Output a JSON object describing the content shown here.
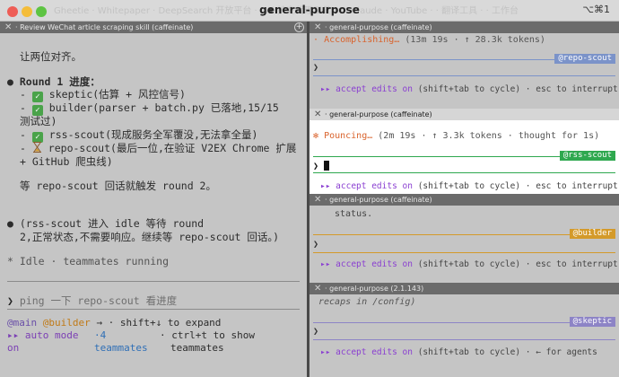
{
  "window": {
    "title": "general-purpose",
    "shortcut": "⌥⌘1",
    "ghost_tabs": "Gheetie · Whitepaper · DeepSearch 开放平台 ·  · Ai 扩充代理工具 ·  ·  · Claude · YouTube ·  · 翻译工具 ·  · 工作台"
  },
  "left_pane": {
    "header": "Review WeChat article scraping skill (caffeinate)",
    "lines": {
      "l1": "让两位对齐。",
      "progress_title": "Round 1 进度：",
      "i1": "skeptic(估算 + 风控信号)",
      "i2a": "builder(parser + batch.py 已落地,15/15",
      "i2b": "测试过)",
      "i3": "rss-scout(现成服务全军覆没,无法拿全量)",
      "i4a": "repo-scout(最后一位,在验证 V2EX Chrome 扩展",
      "i4b": "+ GitHub 爬虫线)",
      "wait": "等  repo-scout 回话就触发  round 2。",
      "p1": "(rss-scout 进入  idle 等待  round",
      "p2": "2,正常状态,不需要响应。继续等  repo-scout 回话。)",
      "idle": "Idle · teammates running"
    },
    "prompt_symbol": "❯",
    "input_value": "ping 一下  repo-scout 看进度",
    "footer": {
      "main": "@main",
      "builder": "@builder",
      "expand": " → · shift+↓ to expand",
      "auto_mode": "▸▸ auto mode",
      "on": "on",
      "count": "·4",
      "teammates": "teammates",
      "ctrl_t": "· ctrl+t to show",
      "teammates2": "teammates"
    }
  },
  "panes": [
    {
      "header": "general-purpose (caffeinate)",
      "status_icon": "·",
      "status": "Accomplishing…",
      "stats": "(13m 19s · ↑ 28.3k tokens)",
      "tag": "@repo-scout",
      "prompt": "❯",
      "accept": "▸▸ accept edits on",
      "hint": "(shift+tab to cycle) · esc to interrupt"
    },
    {
      "header": "general-purpose (caffeinate)",
      "status_icon": "✻",
      "status": "Pouncing…",
      "stats": "(2m 19s · ↑ 3.3k tokens · thought for 1s)",
      "tag": "@rss-scout",
      "prompt": "❯",
      "accept": "▸▸ accept edits on",
      "hint": "(shift+tab to cycle) · esc to interrupt"
    },
    {
      "header": "general-purpose (caffeinate)",
      "prior": "status.",
      "tag": "@builder",
      "prompt": "❯",
      "accept": "▸▸ accept edits on",
      "hint": "(shift+tab to cycle) · esc to interrupt"
    },
    {
      "header": "general-purpose (2.1.143)",
      "prior": "recaps in /config)",
      "tag": "@skeptic",
      "prompt": "❯",
      "accept": "▸▸ accept edits on",
      "hint": "(shift+tab to cycle) · ← for agents"
    }
  ],
  "colors": {
    "repo_scout": "#7b93c9",
    "rss_scout": "#2fa84f",
    "builder": "#d49a2a",
    "skeptic": "#8d84c6",
    "accent_purple": "#8a3fd1",
    "status_orange": "#d9622b"
  }
}
